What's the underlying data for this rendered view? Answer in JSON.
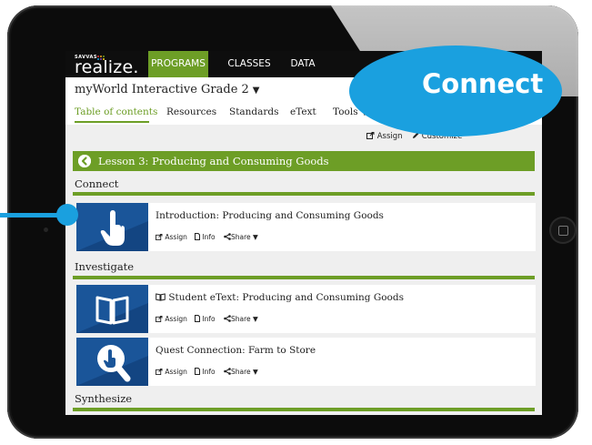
{
  "device": {
    "name": "iPad"
  },
  "brand": {
    "small": "SAVVAS",
    "name": "realize."
  },
  "topnav": {
    "items": [
      "PROGRAMS",
      "CLASSES",
      "DATA"
    ],
    "active": "PROGRAMS"
  },
  "program": {
    "title": "myWorld Interactive Grade 2",
    "caret": "▼"
  },
  "subnav": {
    "items": [
      "Table of contents",
      "Resources",
      "Standards",
      "eText",
      "Tools ▼"
    ],
    "active": "Table of contents"
  },
  "actions": {
    "assign": "Assign",
    "customize": "Customize",
    "assign_icon": "assign-icon",
    "pencil_icon": "pencil-icon"
  },
  "lesson": {
    "title": "Lesson 3: Producing and Consuming Goods"
  },
  "sections": {
    "connect": {
      "heading": "Connect"
    },
    "investigate": {
      "heading": "Investigate"
    },
    "synthesize": {
      "heading": "Synthesize"
    }
  },
  "cards": [
    {
      "title": "Introduction: Producing and Consuming Goods",
      "icon": "hand-pointer-icon"
    },
    {
      "title": "Student eText: Producing and Consuming Goods",
      "icon": "book-icon",
      "title_icon": "book-small-icon"
    },
    {
      "title": "Quest Connection: Farm to Store",
      "icon": "magnifier-icon"
    }
  ],
  "card_actions": {
    "assign": "Assign",
    "info": "Info",
    "share": "Share ▼"
  },
  "callout": {
    "label": "Connect"
  },
  "colors": {
    "green": "#6d9e26",
    "callout_blue": "#1aa0df",
    "thumb_blue": "#1a5599",
    "nav_bg": "#0e0e0e"
  }
}
